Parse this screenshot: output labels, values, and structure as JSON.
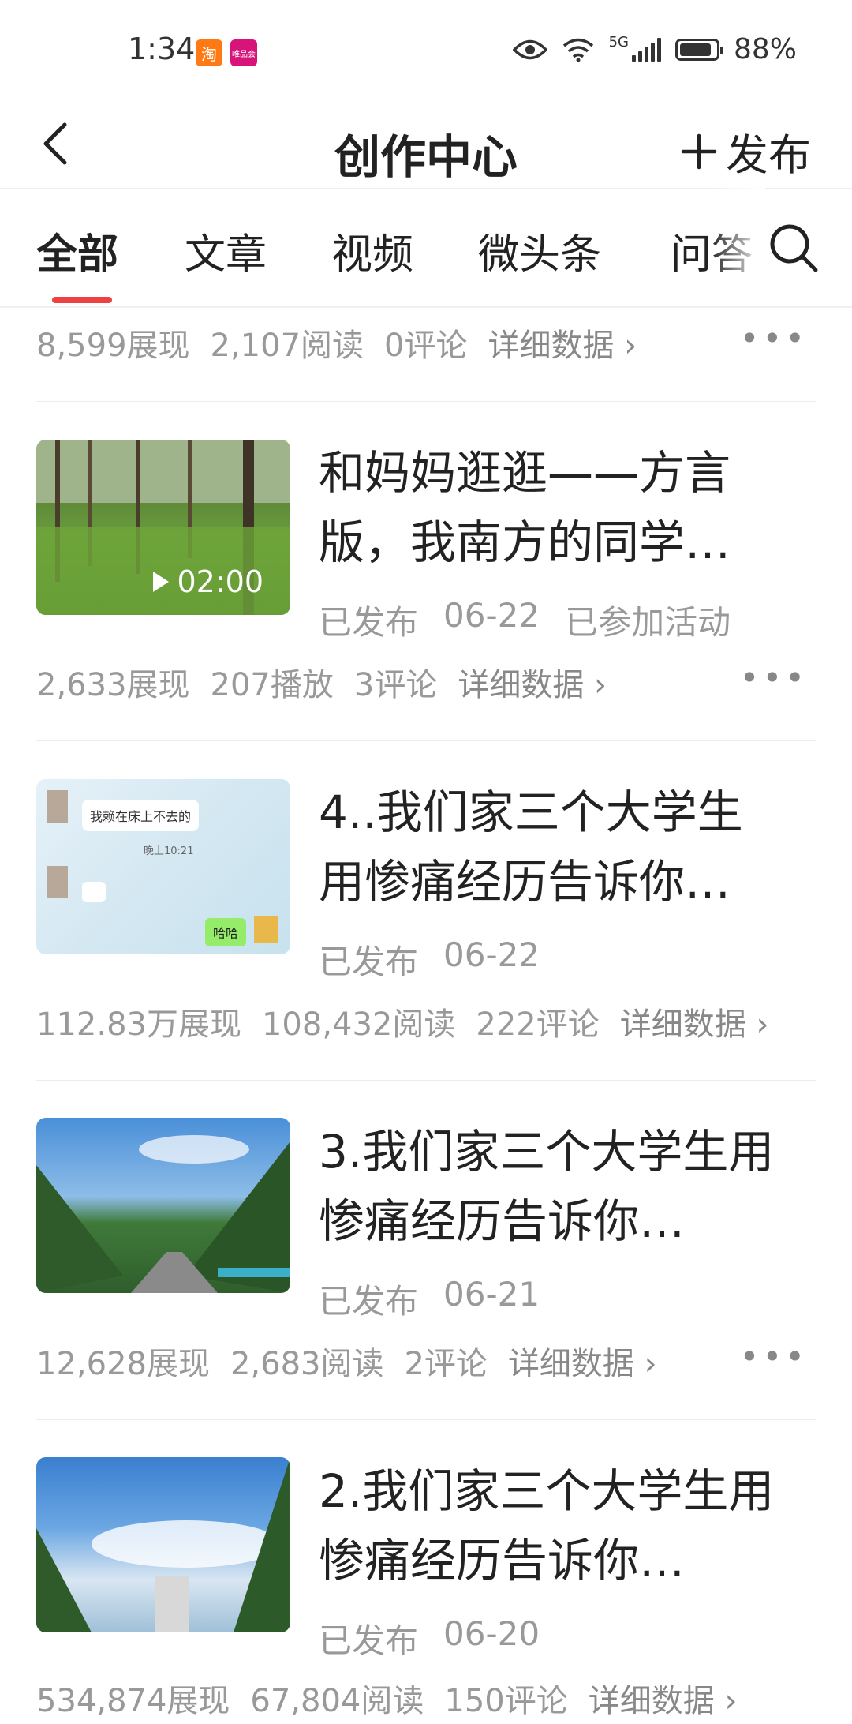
{
  "status": {
    "time": "1:34",
    "network": "5G",
    "battery": "88%",
    "battery_level": 0.88,
    "badge1": "淘",
    "badge2": "唯品会"
  },
  "header": {
    "title": "创作中心",
    "publish": "发布"
  },
  "tabs": [
    "全部",
    "文章",
    "视频",
    "微头条",
    "问答"
  ],
  "partial_stats": {
    "impressions": "8,599展现",
    "reads": "2,107阅读",
    "comments": "0评论",
    "detail": "详细数据",
    "chevron": "›"
  },
  "items": [
    {
      "title_line1": "和妈妈逛逛——方言",
      "title_line2": "版，我南方的同学…",
      "status": "已发布",
      "date": "06-22",
      "extra": "已参加活动",
      "duration": "02:00",
      "stats": {
        "impressions": "2,633展现",
        "reads": "207播放",
        "comments": "3评论",
        "detail": "详细数据",
        "chevron": "›"
      }
    },
    {
      "title_line1": "4..我们家三个大学生",
      "title_line2": "用惨痛经历告诉你…",
      "status": "已发布",
      "date": "06-22",
      "chat": {
        "msg1": "我赖在床上不去的",
        "time": "晚上10:21",
        "reply": "哈哈"
      },
      "stats": {
        "impressions": "112.83万展现",
        "reads": "108,432阅读",
        "comments": "222评论",
        "detail": "详细数据",
        "chevron": "›"
      }
    },
    {
      "title_line1": "3.我们家三个大学生用",
      "title_line2": "惨痛经历告诉你…",
      "status": "已发布",
      "date": "06-21",
      "stats": {
        "impressions": "12,628展现",
        "reads": "2,683阅读",
        "comments": "2评论",
        "detail": "详细数据",
        "chevron": "›"
      }
    },
    {
      "title_line1": "2.我们家三个大学生用",
      "title_line2": "惨痛经历告诉你…",
      "status": "已发布",
      "date": "06-20",
      "stats": {
        "impressions": "534,874展现",
        "reads": "67,804阅读",
        "comments": "150评论",
        "detail": "详细数据",
        "chevron": "›"
      }
    }
  ],
  "icons": [
    "back-icon",
    "plus-icon",
    "search-icon",
    "more-icon",
    "play-icon",
    "eye-icon",
    "wifi-icon",
    "signal-icon",
    "battery-icon"
  ],
  "colors": {
    "accent": "#f04142",
    "text": "#222222",
    "muted": "#999999"
  }
}
